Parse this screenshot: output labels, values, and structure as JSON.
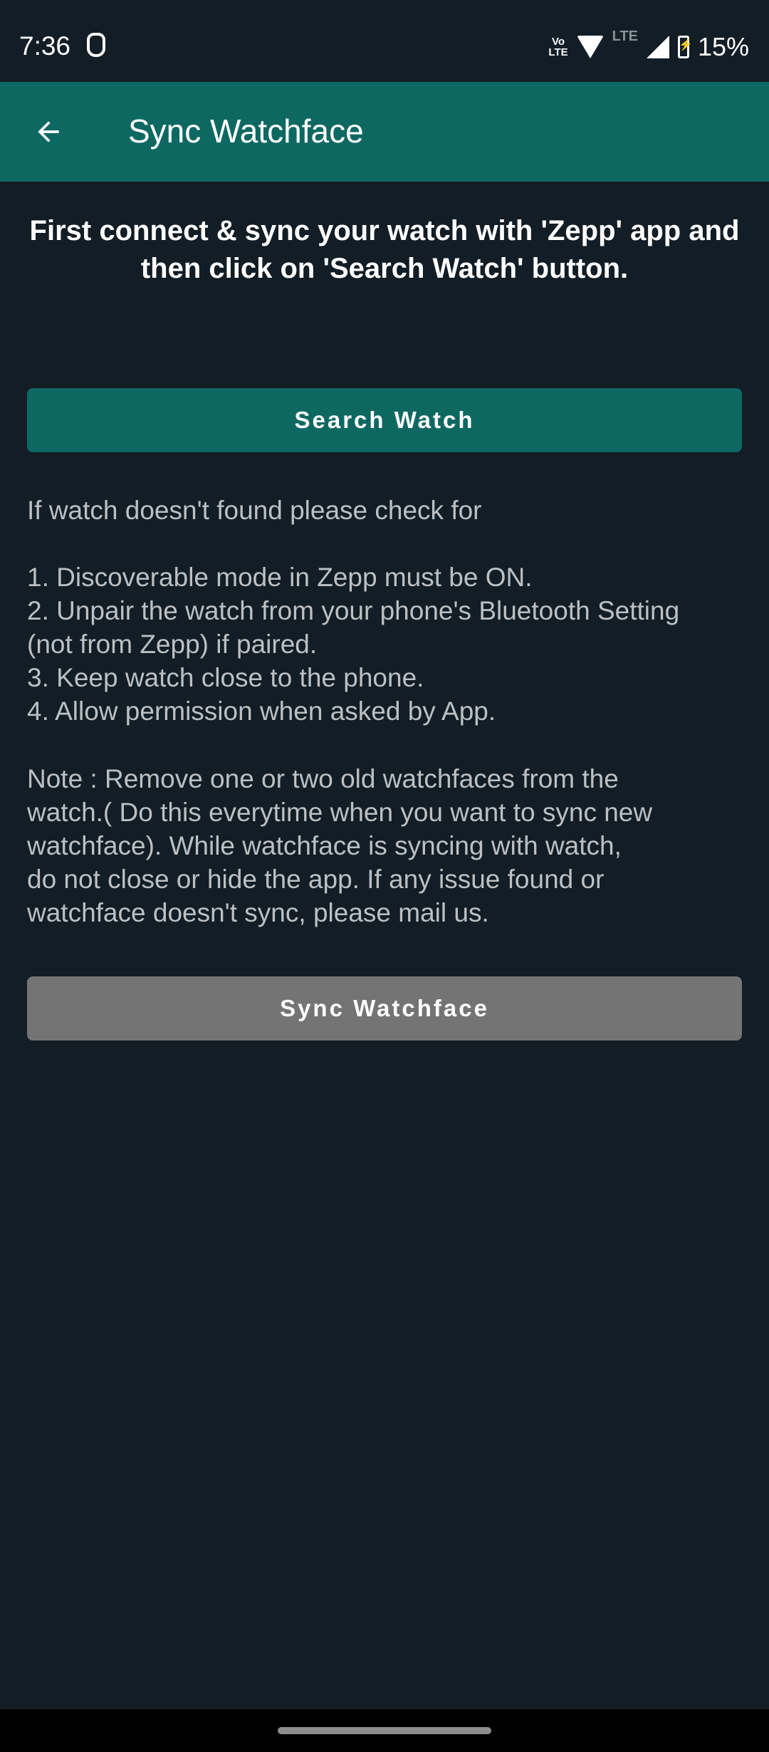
{
  "status_bar": {
    "time": "7:36",
    "volte_label": "Vo\nLTE",
    "network_label": "LTE",
    "battery_percent": "15%",
    "icons": [
      "app-notification-icon",
      "volte-icon",
      "wifi-icon",
      "lte-icon",
      "signal-icon",
      "battery-charging-icon"
    ]
  },
  "app_bar": {
    "title": "Sync Watchface",
    "back_icon": "arrow-left-icon"
  },
  "content": {
    "headline": "First connect & sync your watch with 'Zepp' app and then click on 'Search Watch' button.",
    "search_button_label": "Search Watch",
    "help_text": "If watch doesn't found please check for\n\n1. Discoverable mode in Zepp must be ON.\n2. Unpair the watch from your phone's Bluetooth Setting\n(not from Zepp) if paired.\n3. Keep watch close to the phone.\n4. Allow permission when asked by App.",
    "note_text": "Note : Remove one or two old watchfaces from the\nwatch.( Do this everytime when you want to sync new\nwatchface). While watchface is syncing with watch,\ndo not close or hide the app. If any issue found or\nwatchface doesn't sync, please mail us.",
    "sync_button_label": "Sync Watchface"
  },
  "colors": {
    "accent": "#0e6862",
    "background": "#121d25",
    "disabled_button": "#747474"
  }
}
